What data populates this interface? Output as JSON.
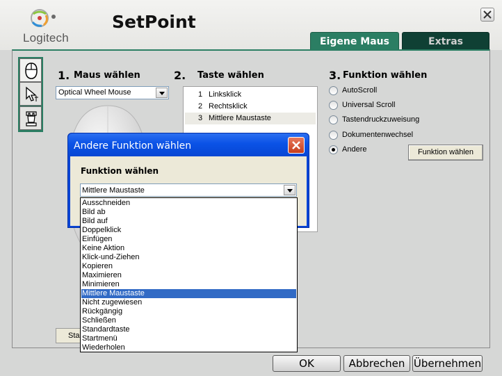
{
  "app": {
    "logo_text": "Logitech",
    "title": "SetPoint"
  },
  "tabs": [
    {
      "label": "Eigene Maus",
      "active": true
    },
    {
      "label": "Extras",
      "active": false
    }
  ],
  "side_icons": [
    "mouse-icon",
    "pointer-icon",
    "chess-rook-icon"
  ],
  "steps": {
    "mouse": {
      "number": "1.",
      "label": "Maus wählen",
      "selected": "Optical Wheel Mouse"
    },
    "button": {
      "number": "2.",
      "label": "Taste wählen",
      "items": [
        {
          "num": "1",
          "label": "Linksklick"
        },
        {
          "num": "2",
          "label": "Rechtsklick"
        },
        {
          "num": "3",
          "label": "Mittlere Maustaste"
        }
      ],
      "selected_index": 2
    },
    "function": {
      "number": "3.",
      "label": "Funktion wählen",
      "options": [
        "AutoScroll",
        "Universal Scroll",
        "Tastendruckzuweisung",
        "Dokumentenwechsel",
        "Andere"
      ],
      "checked_index": 4,
      "choose_button": "Funktion wählen"
    }
  },
  "standard_button": "Sta",
  "bottom_buttons": {
    "ok": "OK",
    "cancel": "Abbrechen",
    "apply": "Übernehmen"
  },
  "dialog": {
    "title": "Andere Funktion wählen",
    "label": "Funktion wählen",
    "selected_value": "Mittlere Maustaste",
    "options": [
      "Ausschneiden",
      "Bild ab",
      "Bild auf",
      "Doppelklick",
      "Einfügen",
      "Keine Aktion",
      "Klick-und-Ziehen",
      "Kopieren",
      "Maximieren",
      "Minimieren",
      "Mittlere Maustaste",
      "Nicht zugewiesen",
      "Rückgängig",
      "Schließen",
      "Standardtaste",
      "Startmenü",
      "Wiederholen"
    ],
    "highlighted_index": 10
  },
  "colors": {
    "tab_active": "#2b7e63",
    "tab_inactive": "#0f4034",
    "dialog_title": "#0a52e6",
    "selection": "#316ac5"
  }
}
